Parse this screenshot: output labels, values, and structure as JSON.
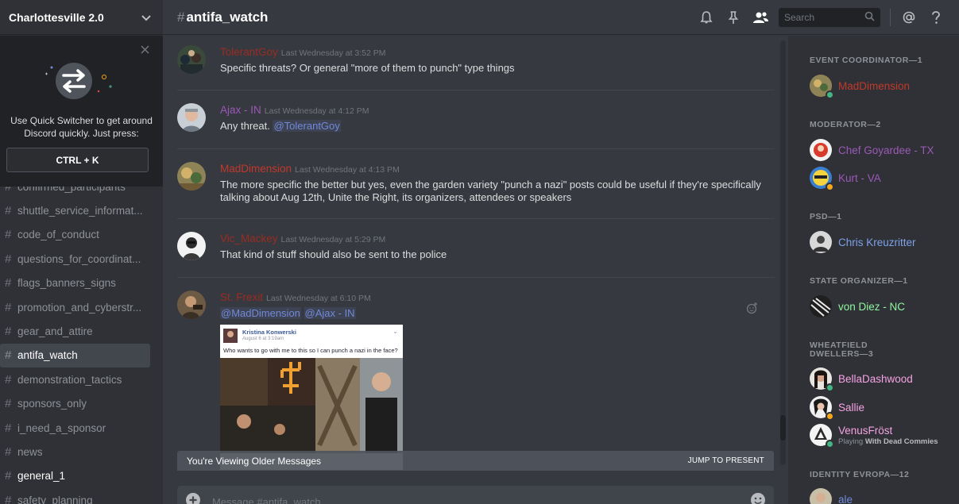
{
  "server": {
    "name": "Charlottesville 2.0"
  },
  "quick_switcher": {
    "text": "Use Quick Switcher to get around Discord quickly. Just press:",
    "shortcut": "CTRL + K"
  },
  "channels": [
    {
      "name": "confirmed_participants",
      "state": "normal"
    },
    {
      "name": "shuttle_service_informat...",
      "state": "normal"
    },
    {
      "name": "code_of_conduct",
      "state": "normal"
    },
    {
      "name": "questions_for_coordinat...",
      "state": "normal"
    },
    {
      "name": "flags_banners_signs",
      "state": "normal"
    },
    {
      "name": "promotion_and_cyberstr...",
      "state": "normal"
    },
    {
      "name": "gear_and_attire",
      "state": "normal"
    },
    {
      "name": "antifa_watch",
      "state": "active"
    },
    {
      "name": "demonstration_tactics",
      "state": "normal"
    },
    {
      "name": "sponsors_only",
      "state": "normal"
    },
    {
      "name": "i_need_a_sponsor",
      "state": "normal"
    },
    {
      "name": "news",
      "state": "normal"
    },
    {
      "name": "general_1",
      "state": "unread"
    },
    {
      "name": "safety_planning",
      "state": "normal"
    }
  ],
  "header": {
    "hash": "#",
    "channel": "antifa_watch",
    "search_placeholder": "Search"
  },
  "messages": [
    {
      "author": "TolerantGoy",
      "color": "#992d22",
      "timestamp": "Last Wednesday at 3:52 PM",
      "text": "Specific threats?  Or general \"more of them to punch\" type things"
    },
    {
      "author": "Ajax - IN",
      "color": "#9b59b6",
      "timestamp": "Last Wednesday at 4:12 PM",
      "text_prefix": "Any threat. ",
      "mention": "@TolerantGoy"
    },
    {
      "author": "MadDimension",
      "color": "#c0392b",
      "timestamp": "Last Wednesday at 4:13 PM",
      "text": "The more specific the better but yes, even the garden variety \"punch a nazi\" posts could be useful if they're specifically talking about Aug 12th, Unite the Right, its organizers, attendees or speakers"
    },
    {
      "author": "Vic_Mackey",
      "color": "#992d22",
      "timestamp": "Last Wednesday at 5:29 PM",
      "text": "That kind of stuff should also be sent to the police"
    },
    {
      "author": "St. Frexit",
      "color": "#992d22",
      "timestamp": "Last Wednesday at 6:10 PM",
      "mentions": [
        "@MadDimension",
        "@Ajax - IN"
      ]
    }
  ],
  "embed": {
    "poster": "Kristina Konwerski",
    "date": "August 6 at 3:19am",
    "post_text": "Who wants to go with me to this so I can punch a nazi in the face?"
  },
  "older_bar": {
    "text": "You're Viewing Older Messages",
    "jump": "JUMP TO PRESENT"
  },
  "composer": {
    "placeholder": "Message #antifa_watch"
  },
  "members": {
    "roles": [
      {
        "title": "EVENT COORDINATOR—1",
        "members": [
          {
            "name": "MadDimension",
            "color": "#c0392b",
            "status": "online"
          }
        ]
      },
      {
        "title": "MODERATOR—2",
        "members": [
          {
            "name": "Chef Goyardee - TX",
            "color": "#9b59b6",
            "status": "none"
          },
          {
            "name": "Kurt - VA",
            "color": "#9b59b6",
            "status": "idle"
          }
        ]
      },
      {
        "title": "PSD—1",
        "members": [
          {
            "name": "Chris Kreuzritter",
            "color": "#7ea2e8",
            "status": "none"
          }
        ]
      },
      {
        "title": "STATE ORGANIZER—1",
        "members": [
          {
            "name": "von Diez - NC",
            "color": "#8ef5a1",
            "status": "none"
          }
        ]
      },
      {
        "title": "WHEATFIELD DWELLERS—3",
        "members": [
          {
            "name": "BellaDashwood",
            "color": "#f5a3e4",
            "status": "online"
          },
          {
            "name": "Sallie",
            "color": "#f5a3e4",
            "status": "idle"
          },
          {
            "name": "VenusFröst",
            "color": "#f5a3e4",
            "status": "online",
            "game_prefix": "Playing ",
            "game": "With Dead Commies"
          }
        ]
      },
      {
        "title": "IDENTITY EVROPA—12",
        "members": [
          {
            "name": "ale",
            "color": "#7289da",
            "status": "none"
          }
        ]
      }
    ]
  },
  "colors": {
    "online": "#43b581",
    "idle": "#faa61a",
    "mention": "#7289da"
  }
}
